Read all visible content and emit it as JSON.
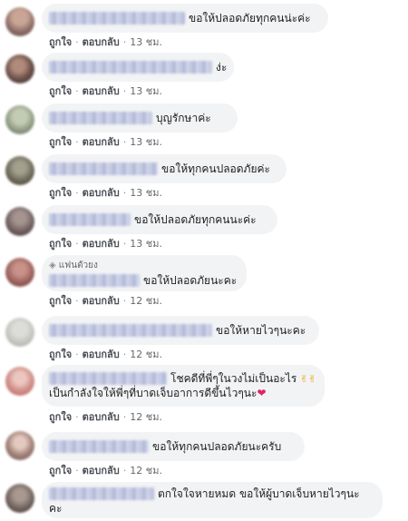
{
  "actions": {
    "like_label": "ถูกใจ",
    "reply_label": "ตอบกลับ",
    "separator": "·"
  },
  "comments": [
    {
      "text": "ขอให้ปลอดภัยทุกคนน่ะค่ะ",
      "time": "13 ชม."
    },
    {
      "text": "ง่ะ",
      "time": "13 ชม."
    },
    {
      "text": "บุญรักษาค่ะ",
      "time": "13 ชม."
    },
    {
      "text": "ขอให้ทุกคนปลอดภัยค่ะ",
      "time": "13 ชม."
    },
    {
      "text": "ขอให้ปลอดภัยทุกคนนะค่ะ",
      "time": "13 ชม."
    },
    {
      "badge": "แฟนตัวยง",
      "text": "ขอให้ปลอดภัยนะคะ",
      "time": "12 ชม."
    },
    {
      "text": "ขอให้หายไวๆนะคะ",
      "time": "12 ชม."
    },
    {
      "text_line1": "โชคดีที่พี่ๆในวงไม่เป็นอะไร",
      "text_line2": "เป็นกำลังใจให้พี่ๆที่บาดเจ็บอาการดีขึ้นไวๆนะ",
      "time": "12 ชม."
    },
    {
      "text": "ขอให้ทุกคนปลอดภัยนะครับ",
      "time": "12 ชม."
    },
    {
      "text_line1": "ตกใจใจหายหมด ขอให้ผู้บาดเจ็บหายไวๆนะ",
      "text_line2": "คะ",
      "time": "12 ชม."
    }
  ],
  "colors": {
    "bubble": "#f2f3f5",
    "link": "#4b4f56",
    "heart": "#e0245e"
  },
  "icons": [
    "diamond-icon",
    "peace-hand-icon",
    "red-heart-icon"
  ]
}
